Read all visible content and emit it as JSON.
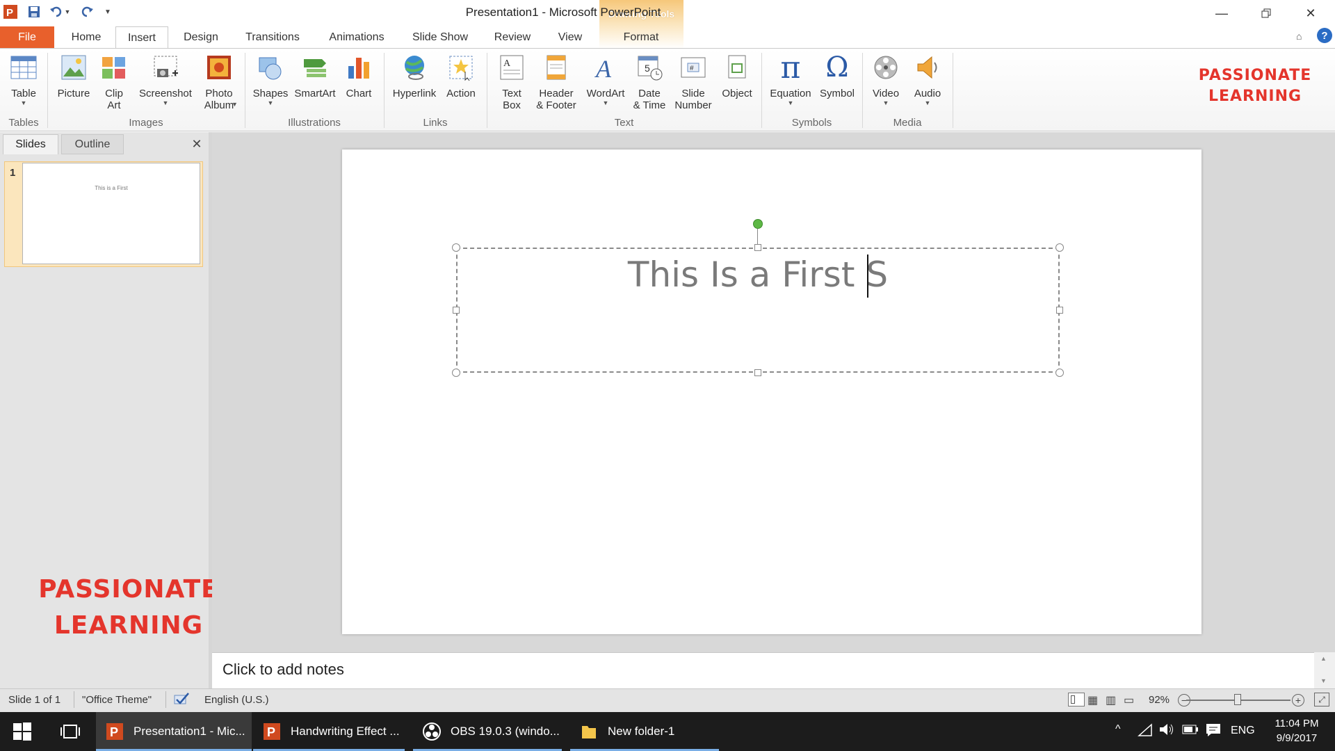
{
  "window": {
    "title": "Presentation1  -  Microsoft PowerPoint",
    "contextual_tab_group": "Drawing Tools"
  },
  "tabs": [
    {
      "label": "File"
    },
    {
      "label": "Home"
    },
    {
      "label": "Insert"
    },
    {
      "label": "Design"
    },
    {
      "label": "Transitions"
    },
    {
      "label": "Animations"
    },
    {
      "label": "Slide Show"
    },
    {
      "label": "Review"
    },
    {
      "label": "View"
    },
    {
      "label": "Format"
    }
  ],
  "ribbon": {
    "buttons": [
      {
        "label": "Table",
        "icon": "table-icon"
      },
      {
        "label": "Picture",
        "icon": "picture-icon"
      },
      {
        "label": "Clip\nArt",
        "icon": "clip-art-icon"
      },
      {
        "label": "Screenshot",
        "icon": "screenshot-icon"
      },
      {
        "label": "Photo\nAlbum",
        "icon": "photo-album-icon"
      },
      {
        "label": "Shapes",
        "icon": "shapes-icon"
      },
      {
        "label": "SmartArt",
        "icon": "smartart-icon"
      },
      {
        "label": "Chart",
        "icon": "chart-icon"
      },
      {
        "label": "Hyperlink",
        "icon": "hyperlink-icon"
      },
      {
        "label": "Action",
        "icon": "action-icon"
      },
      {
        "label": "Text\nBox",
        "icon": "text-box-icon"
      },
      {
        "label": "Header\n& Footer",
        "icon": "header-footer-icon"
      },
      {
        "label": "WordArt",
        "icon": "wordart-icon"
      },
      {
        "label": "Date\n& Time",
        "icon": "date-time-icon"
      },
      {
        "label": "Slide\nNumber",
        "icon": "slide-number-icon"
      },
      {
        "label": "Object",
        "icon": "object-icon"
      },
      {
        "label": "Equation",
        "icon": "equation-icon"
      },
      {
        "label": "Symbol",
        "icon": "symbol-icon"
      },
      {
        "label": "Video",
        "icon": "video-icon"
      },
      {
        "label": "Audio",
        "icon": "audio-icon"
      }
    ],
    "groups": [
      {
        "label": "Tables"
      },
      {
        "label": "Images"
      },
      {
        "label": "Illustrations"
      },
      {
        "label": "Links"
      },
      {
        "label": "Text"
      },
      {
        "label": "Symbols"
      },
      {
        "label": "Media"
      }
    ]
  },
  "left_pane": {
    "tab_slides": "Slides",
    "tab_outline": "Outline",
    "close_glyph": "✕",
    "thumb_number": "1",
    "thumb_text": "This is a First"
  },
  "watermark": {
    "line1": "PASSIONATE",
    "line2": "LEARNING"
  },
  "slide": {
    "title_text": "This Is a First S"
  },
  "notes": {
    "placeholder": "Click to add notes"
  },
  "status": {
    "slide_info": "Slide 1 of 1",
    "theme": "\"Office Theme\"",
    "language": "English (U.S.)",
    "zoom": "92%"
  },
  "taskbar": {
    "apps": [
      {
        "label": "Presentation1 - Mic..."
      },
      {
        "label": "Handwriting Effect ..."
      },
      {
        "label": "OBS 19.0.3 (windo..."
      },
      {
        "label": "New folder-1"
      }
    ],
    "language": "ENG",
    "time": "11:04 PM",
    "date": "9/9/2017"
  },
  "colors": {
    "file_tab": "#e8602c",
    "watermark": "#e4352c",
    "contextual": "#f6c77a",
    "selection": "#fbe6bd"
  }
}
